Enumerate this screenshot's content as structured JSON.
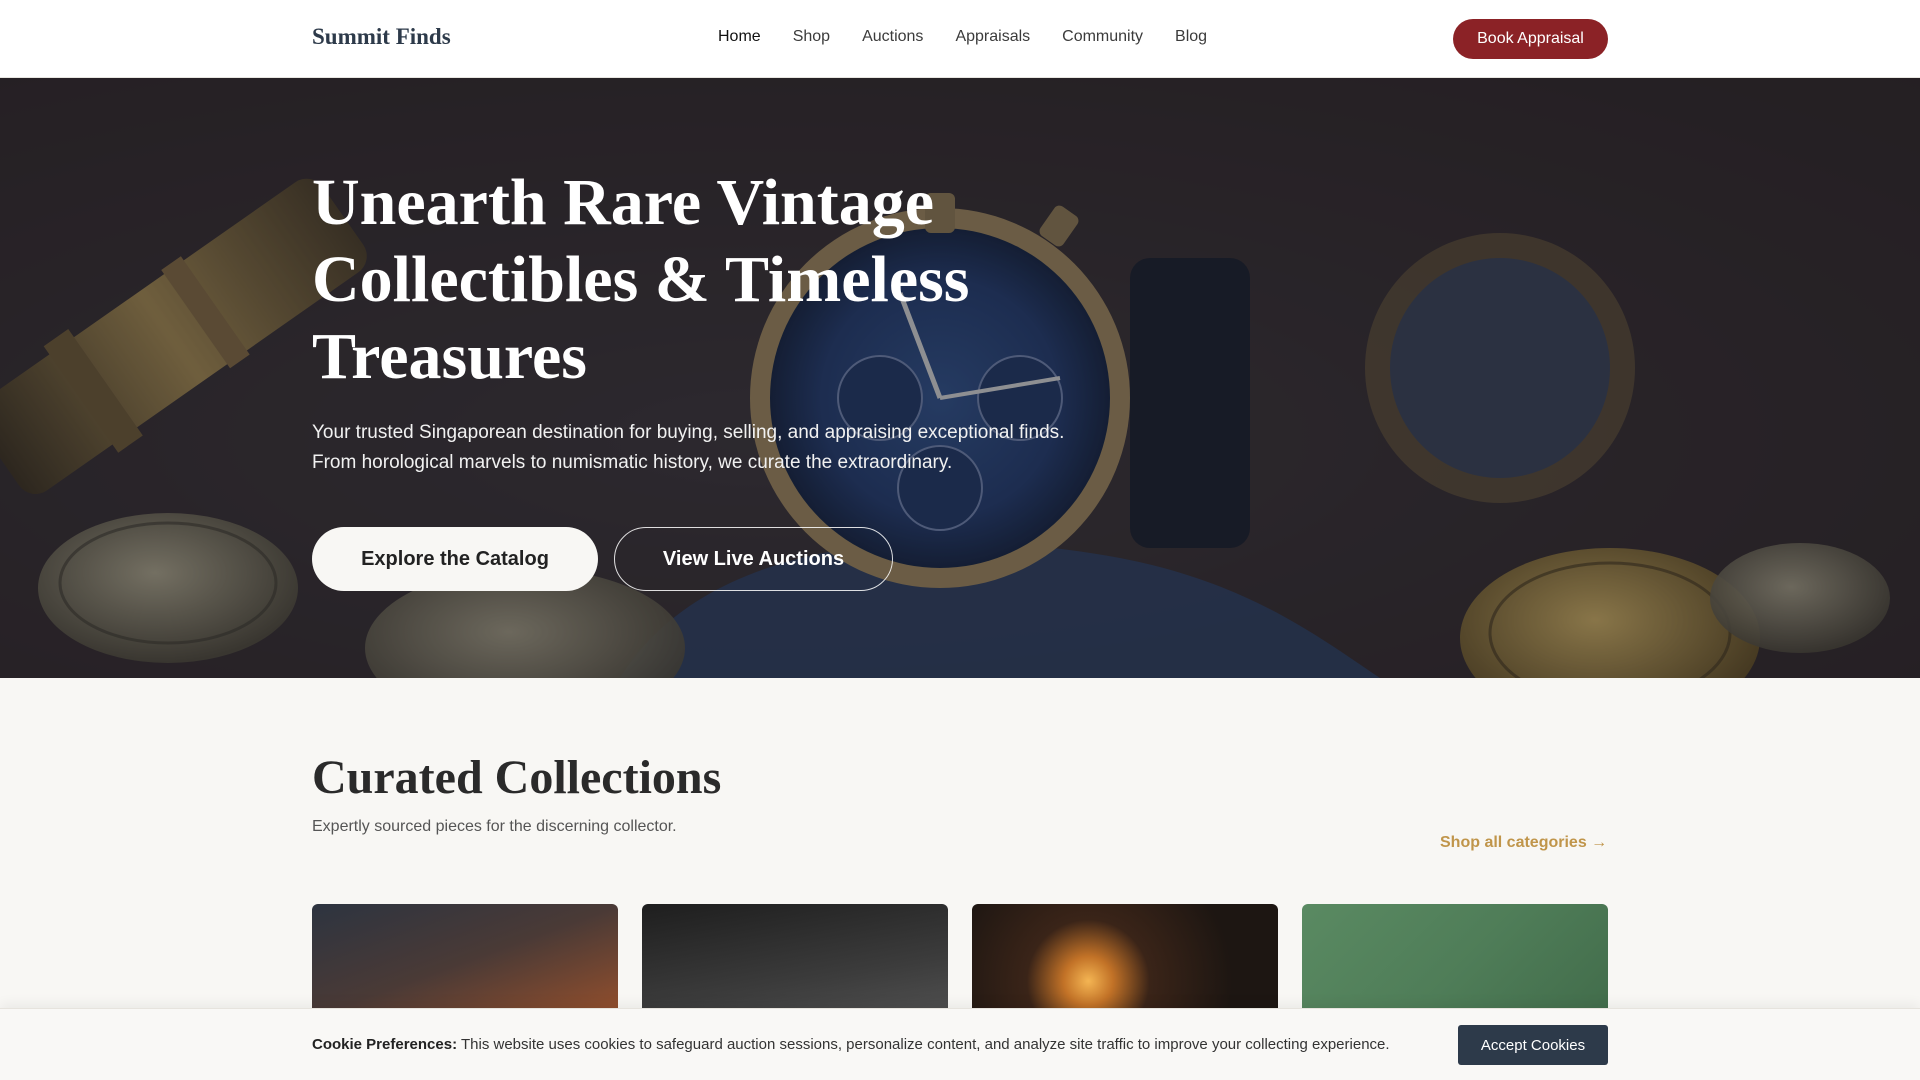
{
  "nav": {
    "brand": "Summit Finds",
    "links": [
      "Home",
      "Shop",
      "Auctions",
      "Appraisals",
      "Community",
      "Blog"
    ],
    "active": "Home",
    "cta": "Book Appraisal"
  },
  "hero": {
    "title": "Unearth Rare Vintage Collectibles & Timeless Treasures",
    "subtitle": "Your trusted Singaporean destination for buying, selling, and appraising exceptional finds. From horological marvels to numismatic history, we curate the extraordinary.",
    "primary_cta": "Explore the Catalog",
    "secondary_cta": "View Live Auctions"
  },
  "collections": {
    "title": "Curated Collections",
    "subtitle": "Expertly sourced pieces for the discerning collector.",
    "shop_all": "Shop all categories →"
  },
  "cookie": {
    "label": "Cookie Preferences:",
    "message": "This website uses cookies to safeguard auction sessions, personalize content, and analyze site traffic to improve your collecting experience.",
    "button": "Accept Cookies"
  },
  "colors": {
    "brand": "#2d3a4a",
    "cta": "#8b2226",
    "accent_link": "#c0954a"
  }
}
